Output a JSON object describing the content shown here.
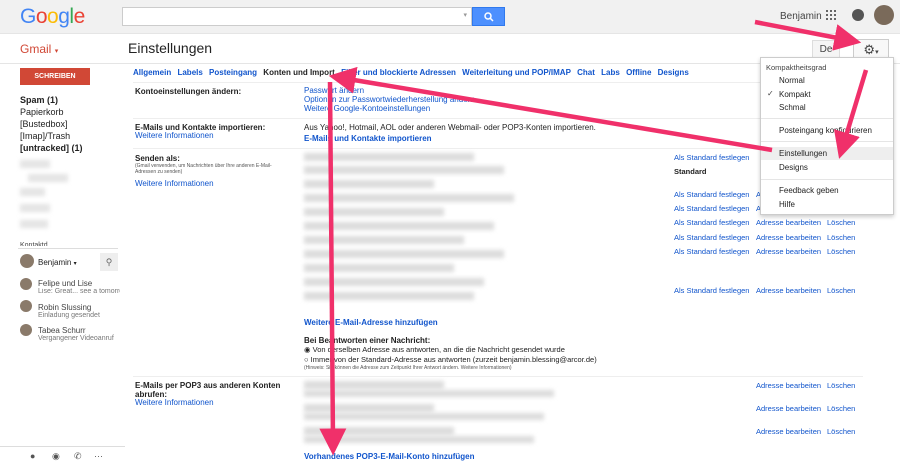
{
  "header": {
    "logo_letters": [
      "G",
      "o",
      "o",
      "g",
      "l",
      "e"
    ],
    "user_name": "Benjamin"
  },
  "subbar": {
    "app_label": "Gmail",
    "page_title": "Einstellungen",
    "lang_button": "De"
  },
  "sidebar": {
    "compose_label": "SCHREIBEN",
    "items": [
      {
        "label": "Spam (1)",
        "bold": true
      },
      {
        "label": "Papierkorb",
        "bold": false
      },
      {
        "label": "[Bustedbox]",
        "bold": false
      },
      {
        "label": "[Imap]/Trash",
        "bold": false
      },
      {
        "label": "[untracked] (1)",
        "bold": true
      }
    ],
    "hangout_user": "Benjamin",
    "contacts": [
      {
        "name": "Felipe und Lise",
        "status": "Lise: Great... see a tomorrow"
      },
      {
        "name": "Robin Slussing",
        "status": "Einladung gesendet"
      },
      {
        "name": "Tabea Schurr",
        "status": "Vergangener Videoanruf"
      }
    ],
    "cutoff_label": "Kontaktd"
  },
  "tabs": [
    "Allgemein",
    "Labels",
    "Posteingang",
    "Konten und Import",
    "Filter und blockierte Adressen",
    "Weiterleitung und POP/IMAP",
    "Chat",
    "Labs",
    "Offline",
    "Designs"
  ],
  "active_tab": "Konten und Import",
  "sections": {
    "konto": {
      "label": "Kontoeinstellungen ändern:",
      "links": [
        "Passwort ändern",
        "Optionen zur Passwortwiederherstellung ändern",
        "Weitere Google-Kontoeinstellungen"
      ]
    },
    "import": {
      "label": "E-Mails und Kontakte importieren:",
      "more": "Weitere Informationen",
      "text": "Aus Yahoo!, Hotmail, AOL oder anderen Webmail- oder POP3-Konten importieren.",
      "link": "E-Mails und Kontakte importieren"
    },
    "senden": {
      "label": "Senden als:",
      "note": "(Gmail verwenden, um Nachrichten über Ihre anderen E-Mail-Adressen zu senden)",
      "more": "Weitere Informationen",
      "set_default": "Als Standard festlegen",
      "edit": "Adresse bearbeiten",
      "delete": "Löschen",
      "standard": "Standard",
      "add_link": "Weitere E-Mail-Adresse hinzufügen",
      "reply_heading": "Bei Beantworten einer Nachricht:",
      "reply_opt1": "Von derselben Adresse aus antworten, an die die Nachricht gesendet wurde",
      "reply_opt2": "Immer von der Standard-Adresse aus antworten (zurzeit benjamin.blessing@arcor.de)",
      "reply_note": "(Hinweis: Sie können die Adresse zum Zeitpunkt Ihrer Antwort ändern. Weitere Informationen)"
    },
    "pop3": {
      "label": "E-Mails per POP3 aus anderen Konten abrufen:",
      "more": "Weitere Informationen",
      "edit": "Adresse bearbeiten",
      "delete": "Löschen",
      "add_link": "Vorhandenes POP3-E-Mail-Konto hinzufügen"
    }
  },
  "menu": {
    "header": "Kompaktheitsgrad",
    "density": [
      "Normal",
      "Kompakt",
      "Schmal"
    ],
    "selected_density": "Kompakt",
    "items": [
      "Posteingang konfigurieren",
      "Einstellungen",
      "Designs",
      "Feedback geben",
      "Hilfe"
    ],
    "highlighted": "Einstellungen"
  },
  "colors": {
    "arrow": "#f0306a",
    "link": "#1155cc",
    "gmail_red": "#d14836",
    "search_blue": "#4d90fe"
  },
  "logo_colors": [
    "#4285f4",
    "#ea4335",
    "#fbbc05",
    "#4285f4",
    "#34a853",
    "#ea4335"
  ]
}
